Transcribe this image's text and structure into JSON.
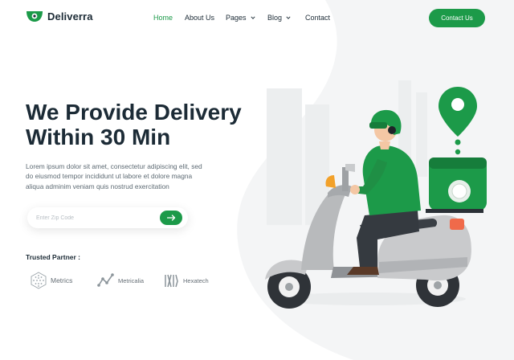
{
  "brand": {
    "name": "Deliverra",
    "accent": "#1c9a49",
    "dark": "#1c2b36"
  },
  "nav": {
    "items": [
      {
        "label": "Home",
        "active": true,
        "dropdown": false
      },
      {
        "label": "About Us",
        "active": false,
        "dropdown": false
      },
      {
        "label": "Pages",
        "active": false,
        "dropdown": true
      },
      {
        "label": "Blog",
        "active": false,
        "dropdown": true
      },
      {
        "label": "Contact",
        "active": false,
        "dropdown": false
      }
    ],
    "cta_label": "Contact Us"
  },
  "hero": {
    "title_lines": [
      "We Provide Delivery",
      "Within 30 Min"
    ],
    "description_lines": [
      "Lorem ipsum dolor sit amet, consectetur adipiscing elit, sed",
      "do eiusmod tempor incididunt ut labore et dolore magna",
      "aliqua adminim veniam quis nostrud exercitation"
    ]
  },
  "search": {
    "placeholder": "Enter Zip Code",
    "button_icon": "arrow-right-icon"
  },
  "partners": {
    "title": "Trusted Partner :",
    "items": [
      {
        "name": "Metrics",
        "icon": "metrics-hexagon-icon"
      },
      {
        "name": "Metricalia",
        "icon": "metricalia-graph-icon"
      },
      {
        "name": "Hexatech",
        "icon": "hexatech-bars-icon"
      }
    ]
  },
  "illustration": {
    "subject": "delivery-scooter-rider",
    "pin_icon": "location-pin-icon"
  }
}
